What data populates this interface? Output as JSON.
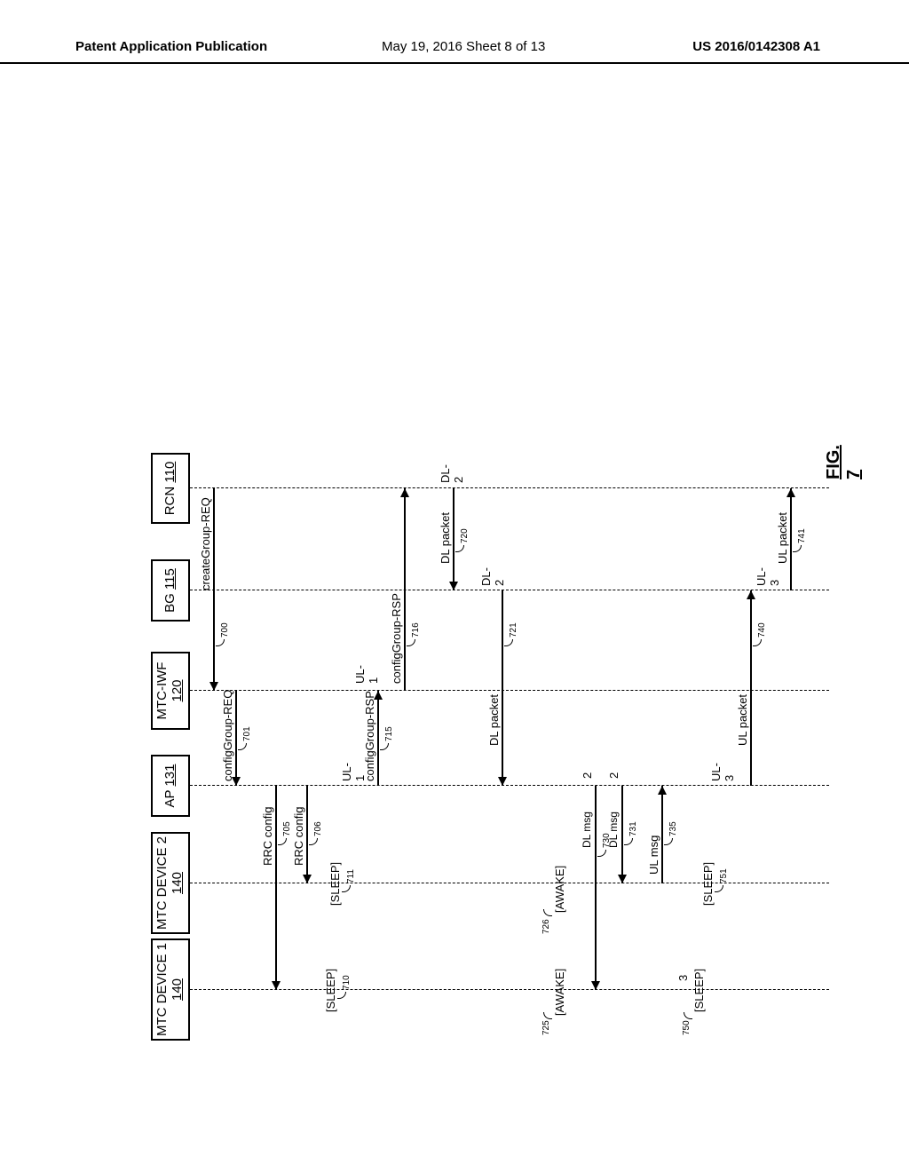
{
  "header": {
    "left": "Patent Application Publication",
    "center": "May 19, 2016  Sheet 8 of 13",
    "right": "US 2016/0142308 A1"
  },
  "figure_label": {
    "prefix": "FIG. ",
    "num": "7"
  },
  "lifelines": {
    "mtc1": {
      "title": "MTC DEVICE 1",
      "ref": "140"
    },
    "mtc2": {
      "title": "MTC DEVICE 2",
      "ref": "140"
    },
    "ap": {
      "title": "AP ",
      "ref": "131"
    },
    "iwf": {
      "title": "MTC-IWF",
      "ref": "120"
    },
    "bg": {
      "title": "BG ",
      "ref": "115"
    },
    "rcn": {
      "title": "RCN ",
      "ref": "110"
    }
  },
  "messages": {
    "createGroupREQ": "createGroup-REQ",
    "configGroupREQ": "configGroup-REQ",
    "rrcConfig1": "RRC config",
    "rrcConfig2": "RRC config",
    "configGroupRSP1": "configGroup-RSP",
    "configGroupRSP2": "configGroup-RSP",
    "dlPacket1": "DL packet",
    "dlPacket2": "DL packet",
    "dlMsg1": "DL msg",
    "dlMsg2": "DL msg",
    "ulMsg": "UL msg",
    "ulPacket1": "UL packet",
    "ulPacket2": "UL packet",
    "ul1a": "UL-1",
    "ul1b": "UL-1",
    "dl2a": "DL-2",
    "dl2b": "DL-2",
    "ul3a": "UL-3",
    "ul3b": "UL-3",
    "two_a": "2",
    "two_b": "2",
    "three": "3"
  },
  "refs": {
    "r700": "700",
    "r701": "701",
    "r705": "705",
    "r706": "706",
    "r710": "710",
    "r711": "711",
    "r715": "715",
    "r716": "716",
    "r720": "720",
    "r721": "721",
    "r725": "725",
    "r726": "726",
    "r730": "730",
    "r731": "731",
    "r735": "735",
    "r740": "740",
    "r741": "741",
    "r750": "750",
    "r751": "751"
  },
  "states": {
    "sleep1": "[SLEEP]",
    "sleep2": "[SLEEP]",
    "awake1": "[AWAKE]",
    "awake2": "[AWAKE]",
    "sleep3": "[SLEEP]",
    "sleep4": "[SLEEP]"
  },
  "chart_data": {
    "type": "sequence-diagram",
    "lifelines": [
      {
        "id": "MTC_DEVICE_1",
        "label": "MTC DEVICE 1",
        "ref": "140"
      },
      {
        "id": "MTC_DEVICE_2",
        "label": "MTC DEVICE 2",
        "ref": "140"
      },
      {
        "id": "AP",
        "label": "AP",
        "ref": "131"
      },
      {
        "id": "MTC_IWF",
        "label": "MTC-IWF",
        "ref": "120"
      },
      {
        "id": "BG",
        "label": "BG",
        "ref": "115"
      },
      {
        "id": "RCN",
        "label": "RCN",
        "ref": "110"
      }
    ],
    "messages": [
      {
        "from": "RCN",
        "to": "MTC_IWF",
        "label": "createGroup-REQ",
        "ref": "700"
      },
      {
        "from": "MTC_IWF",
        "to": "AP",
        "label": "configGroup-REQ",
        "ref": "701"
      },
      {
        "from": "AP",
        "to": "MTC_DEVICE_1",
        "label": "RRC config",
        "ref": "705"
      },
      {
        "from": "AP",
        "to": "MTC_DEVICE_2",
        "label": "RRC config",
        "ref": "706"
      },
      {
        "from": "AP",
        "to": "MTC_IWF",
        "label": "configGroup-RSP",
        "ref": "715",
        "note": "UL-1"
      },
      {
        "from": "MTC_IWF",
        "to": "RCN",
        "label": "configGroup-RSP",
        "ref": "716",
        "note": "UL-1"
      },
      {
        "from": "RCN",
        "to": "BG",
        "label": "DL packet",
        "ref": "720",
        "note": "DL-2"
      },
      {
        "from": "BG",
        "to": "AP",
        "label": "DL packet",
        "ref": "721",
        "note": "DL-2"
      },
      {
        "from": "AP",
        "to": "MTC_DEVICE_1",
        "label": "DL msg",
        "ref": "730",
        "note": "2"
      },
      {
        "from": "AP",
        "to": "MTC_DEVICE_2",
        "label": "DL msg",
        "ref": "731",
        "note": "2"
      },
      {
        "from": "MTC_DEVICE_2",
        "to": "AP",
        "label": "UL msg",
        "ref": "735"
      },
      {
        "from": "AP",
        "to": "BG",
        "label": "UL packet",
        "ref": "740",
        "note": "UL-3"
      },
      {
        "from": "BG",
        "to": "RCN",
        "label": "UL packet",
        "ref": "741",
        "note": "UL-3"
      }
    ],
    "states": [
      {
        "lifeline": "MTC_DEVICE_1",
        "state": "SLEEP",
        "ref": "710"
      },
      {
        "lifeline": "MTC_DEVICE_2",
        "state": "SLEEP",
        "ref": "711"
      },
      {
        "lifeline": "MTC_DEVICE_1",
        "state": "AWAKE",
        "ref": "725"
      },
      {
        "lifeline": "MTC_DEVICE_2",
        "state": "AWAKE",
        "ref": "726"
      },
      {
        "lifeline": "MTC_DEVICE_1",
        "state": "SLEEP",
        "ref": "750",
        "note": "3"
      },
      {
        "lifeline": "MTC_DEVICE_2",
        "state": "SLEEP",
        "ref": "751"
      }
    ],
    "figure": "FIG. 7"
  }
}
